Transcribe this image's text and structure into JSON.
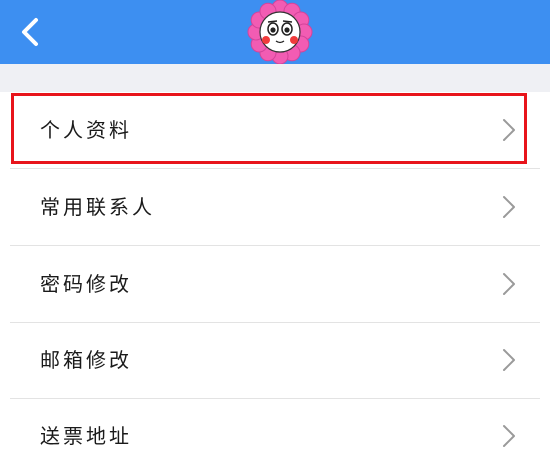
{
  "header": {
    "back_icon": "chevron-left-icon",
    "mascot_icon": "flower-mascot-icon",
    "background_color": "#3d8ff1"
  },
  "menu": {
    "items": [
      {
        "label": "个人资料",
        "icon": "chevron-right-icon",
        "highlighted": true
      },
      {
        "label": "常用联系人",
        "icon": "chevron-right-icon"
      },
      {
        "label": "密码修改",
        "icon": "chevron-right-icon"
      },
      {
        "label": "邮箱修改",
        "icon": "chevron-right-icon"
      },
      {
        "label": "送票地址",
        "icon": "chevron-right-icon"
      }
    ]
  },
  "colors": {
    "accent": "#3d8ff1",
    "highlight": "#e8141b",
    "band": "#eff0f4",
    "divider": "#e3e3e3",
    "chevron": "#9a9a9a"
  }
}
